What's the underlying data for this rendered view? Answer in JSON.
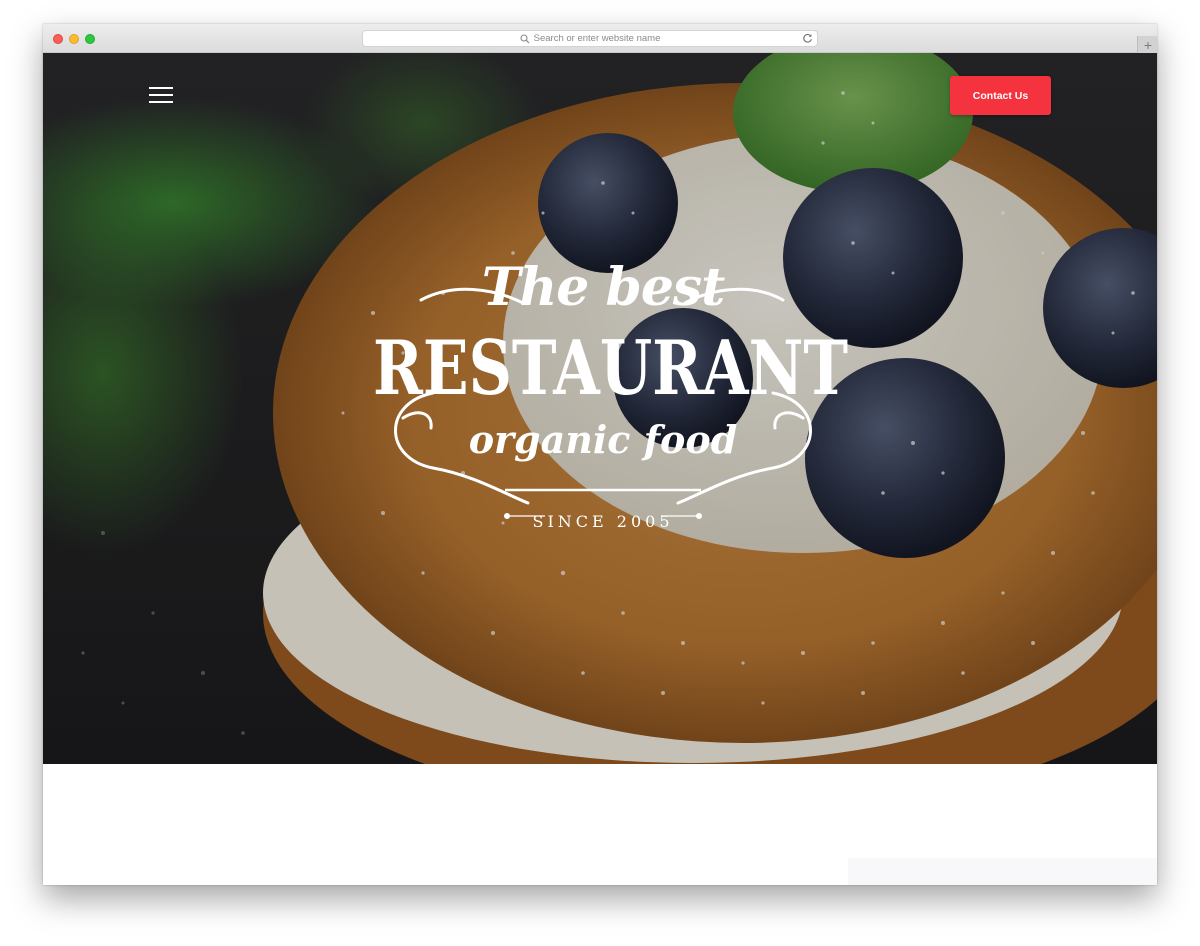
{
  "browser": {
    "address_placeholder": "Search or enter website name",
    "new_tab_glyph": "+"
  },
  "header": {
    "menu_icon": "hamburger-menu-icon",
    "contact_label": "Contact Us"
  },
  "hero": {
    "logo_line1": "The best",
    "logo_line2": "RESTAURANT",
    "logo_line3": "organic food",
    "logo_since": "SINCE 2005"
  },
  "colors": {
    "contact_button": "#f5333f",
    "traffic_red": "#fd5d55",
    "traffic_yellow": "#fdbc2e",
    "traffic_green": "#2bc840"
  }
}
